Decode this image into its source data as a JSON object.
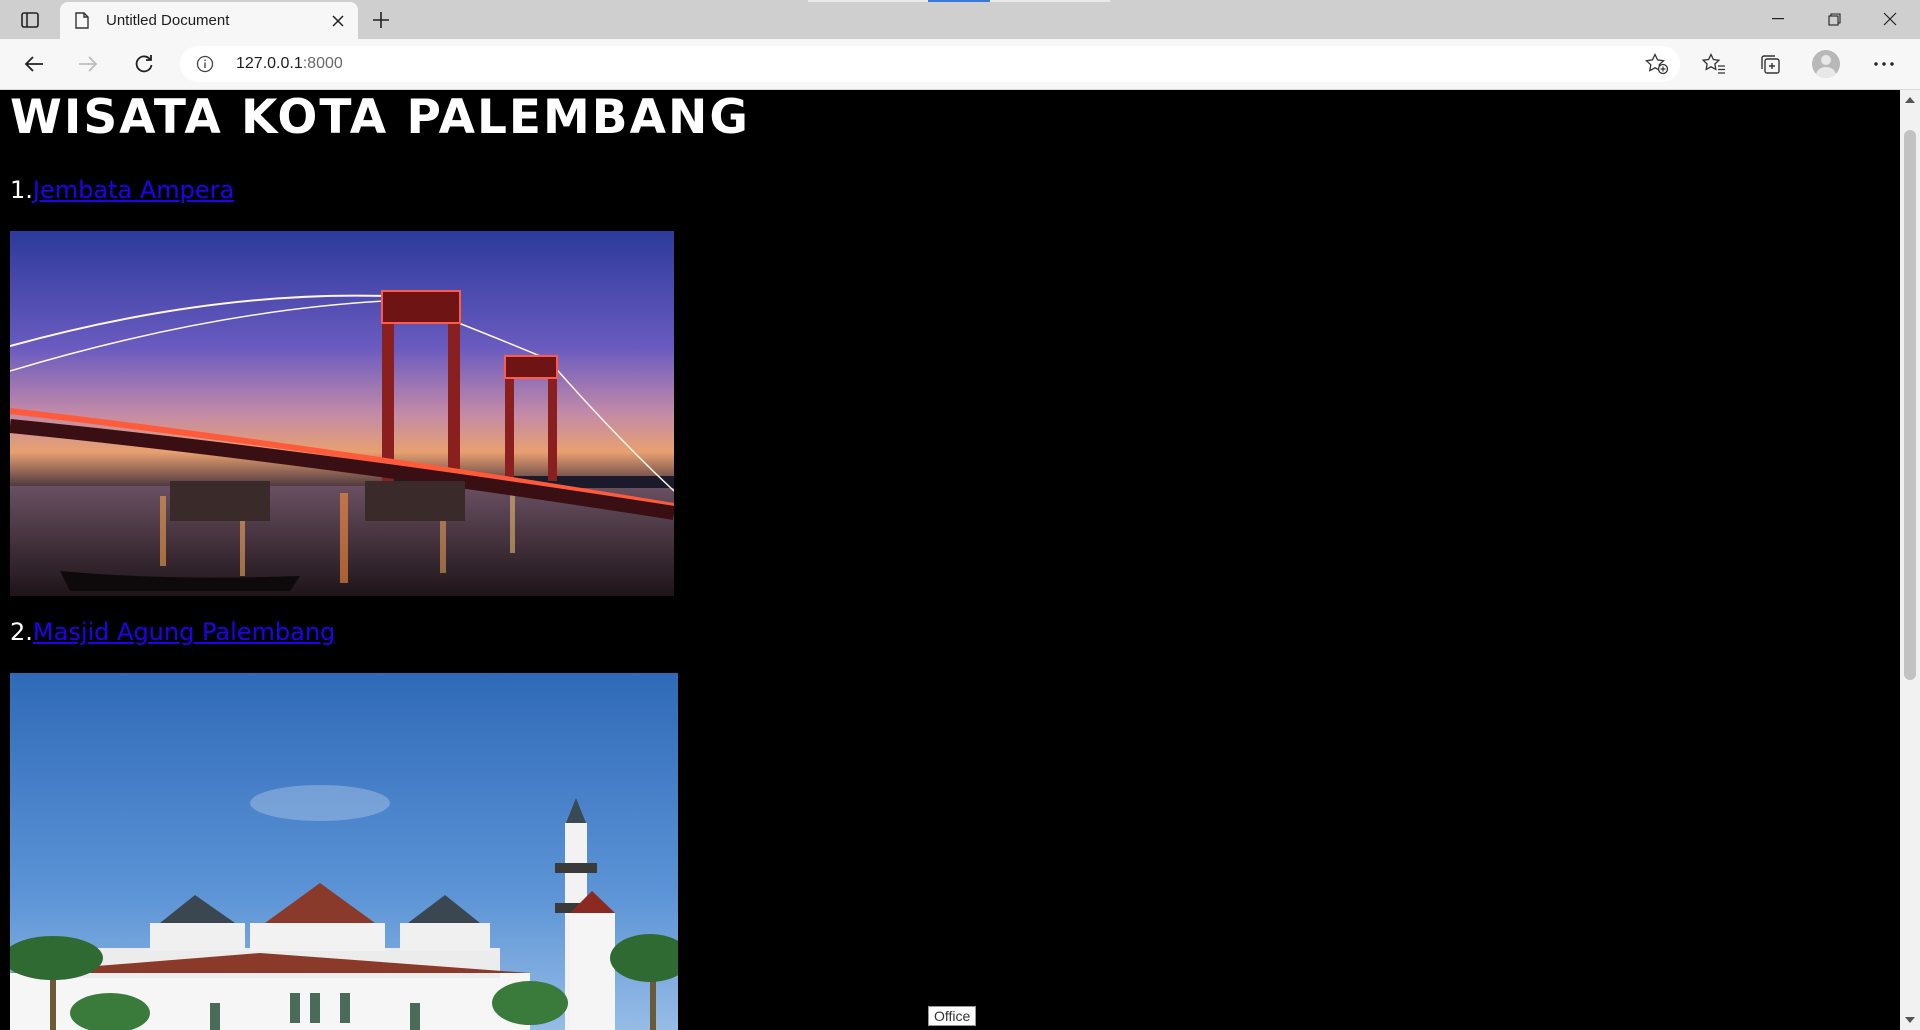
{
  "browser": {
    "tab_title": "Untitled Document",
    "url_host": "127.0.0.1",
    "url_port": ":8000"
  },
  "page": {
    "heading": "WISATA KOTA PALEMBANG",
    "items": [
      {
        "number": "1.",
        "link": "Jembata Ampera"
      },
      {
        "number": "2.",
        "link": "Masjid Agung Palembang"
      }
    ]
  },
  "tooltip": "Office",
  "colors": {
    "link": "#2200ee",
    "page_background": "#000000"
  }
}
